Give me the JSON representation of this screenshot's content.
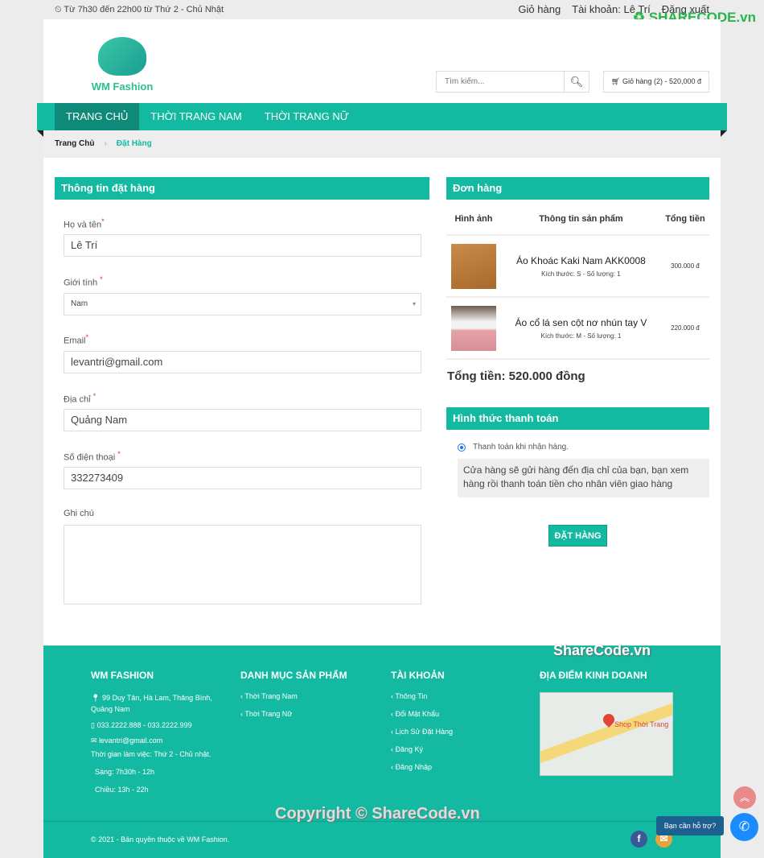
{
  "topbar": {
    "hours": "⏲ Từ 7h30 đến 22h00 từ Thứ 2 - Chủ Nhật",
    "cart": "Giỏ hàng",
    "account": "Tài khoản: Lê Trí",
    "logout": "Đăng xuất"
  },
  "watermarks": {
    "logo": "SHARECODE.vn",
    "top": "ShareCode.vn",
    "copyright": "Copyright © ShareCode.vn"
  },
  "header": {
    "logo_text": "WM Fashion",
    "search_placeholder": "Tìm kiếm...",
    "cart_summary": "Giỏ hàng (2) - 520,000 đ"
  },
  "nav": [
    "TRANG CHỦ",
    "THỜI TRANG NAM",
    "THỜI TRANG NỮ"
  ],
  "breadcrumb": {
    "home": "Trang Chủ",
    "sep": "›",
    "current": "Đặt Hàng"
  },
  "form": {
    "title": "Thông tin đặt hàng",
    "name_label": "Họ và tên",
    "name": "Lê Trí",
    "gender_label": "Giới tính",
    "gender": "Nam",
    "email_label": "Email",
    "email": "levantri@gmail.com",
    "address_label": "Địa chỉ",
    "address": "Quảng Nam",
    "phone_label": "Số điện thoại",
    "phone": "332273409",
    "note_label": "Ghi chú",
    "required": "*"
  },
  "order": {
    "title": "Đơn hàng",
    "headers": [
      "Hình ảnh",
      "Thông tin sản phẩm",
      "Tổng tiền"
    ],
    "items": [
      {
        "name": "Áo Khoác Kaki Nam AKK0008",
        "meta": "Kích thước: S - Số lượng: 1",
        "price": "300.000 đ"
      },
      {
        "name": "Áo cổ lá sen cột nơ nhún tay V",
        "meta": "Kích thước: M - Số lượng: 1",
        "price": "220.000 đ"
      }
    ],
    "total": "Tổng tiền: 520.000 đồng"
  },
  "payment": {
    "title": "Hình thức thanh toán",
    "option": "Thanh toán khi nhận hàng.",
    "note": "Cửa hàng sẽ gửi hàng đến địa chỉ của bạn, bạn xem hàng rồi thanh toán tiền cho nhân viên giao hàng",
    "submit": "ĐẶT HÀNG"
  },
  "footer": {
    "brand": {
      "title": "WM FASHION",
      "address": "99 Duy Tân, Hà Lam, Thăng Bình, Quảng Nam",
      "phone": "033.2222.888 - 033.2222.999",
      "email": "levantri@gmail.com",
      "hours": "Thời gian làm việc: Thứ 2 - Chủ nhật.",
      "morning": "Sáng: 7h30h - 12h",
      "afternoon": "Chiều: 13h - 22h"
    },
    "categories": {
      "title": "DANH MỤC SẢN PHẨM",
      "items": [
        "Thời Trang Nam",
        "Thời Trang Nữ"
      ]
    },
    "account": {
      "title": "TÀI KHOẢN",
      "items": [
        "Thông Tin",
        "Đổi Mật Khẩu",
        "Lịch Sử Đặt Hàng",
        "Đăng Ký",
        "Đăng Nhập"
      ]
    },
    "location": {
      "title": "ĐỊA ĐIỂM KINH DOANH",
      "map_label": "Shop Thời Trang"
    },
    "copyright": "© 2021 - Bản quyền thuộc về WM Fashion."
  },
  "chat": {
    "help": "Bạn cần hỗ trợ?"
  },
  "colors": {
    "primary": "#14b9a2",
    "active_nav": "#0f8a78"
  }
}
